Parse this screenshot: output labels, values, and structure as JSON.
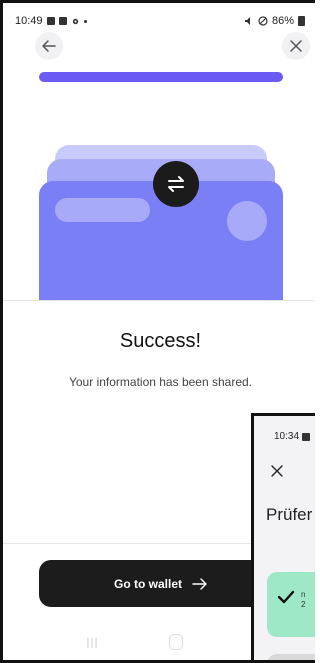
{
  "status_bar": {
    "time": "10:49",
    "battery": "86%"
  },
  "progress": {
    "value": 1.0
  },
  "result": {
    "title": "Success!",
    "message": "Your information has been shared."
  },
  "actions": {
    "go_to_wallet": "Go to wallet"
  },
  "colors": {
    "accent": "#6b5af3",
    "card": "#7b7ff5",
    "button": "#1c1c1c"
  },
  "overlay_screen": {
    "time": "10:34",
    "title_partial": "Prüfer",
    "card_text_partial": "n",
    "card_subtext_partial": "2"
  }
}
